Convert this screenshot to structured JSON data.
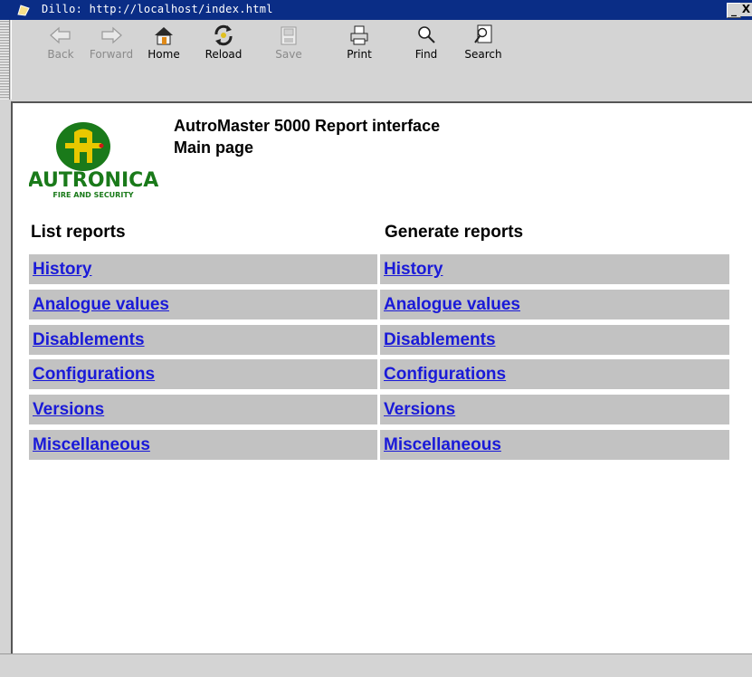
{
  "window": {
    "title": "Dillo: http://localhost/index.html",
    "minimize_label": "_",
    "close_label": "X"
  },
  "toolbar": {
    "buttons": [
      {
        "label": "Back",
        "icon": "back-arrow-icon",
        "enabled": false
      },
      {
        "label": "Forward",
        "icon": "forward-arrow-icon",
        "enabled": false
      },
      {
        "label": "Home",
        "icon": "home-icon",
        "enabled": true
      },
      {
        "label": "Reload",
        "icon": "reload-icon",
        "enabled": true
      },
      {
        "label": "Save",
        "icon": "save-icon",
        "enabled": false
      },
      {
        "label": "Print",
        "icon": "printer-icon",
        "enabled": true
      },
      {
        "label": "Find",
        "icon": "magnifier-icon",
        "enabled": true
      },
      {
        "label": "Search",
        "icon": "search-icon",
        "enabled": true
      }
    ]
  },
  "page": {
    "logo": {
      "text": "AUTRONICA",
      "subtext": "FIRE AND SECURITY",
      "letter": "A",
      "color": "#1a7a1a",
      "accent": "#e8c800"
    },
    "heading": {
      "line1": "AutroMaster 5000 Report interface",
      "line2": "Main page"
    },
    "list_reports": {
      "title": "List reports",
      "items": [
        "History",
        "Analogue values",
        "Disablements",
        "Configurations",
        "Versions",
        "Miscellaneous"
      ]
    },
    "generate_reports": {
      "title": "Generate reports",
      "items": [
        "History",
        "Analogue values",
        "Disablements",
        "Configurations",
        "Versions",
        "Miscellaneous"
      ]
    }
  },
  "colors": {
    "titlebar": "#0a2d86",
    "link": "#1a1ad8",
    "cell_bg": "#c2c2c2",
    "chrome": "#d4d4d4"
  }
}
